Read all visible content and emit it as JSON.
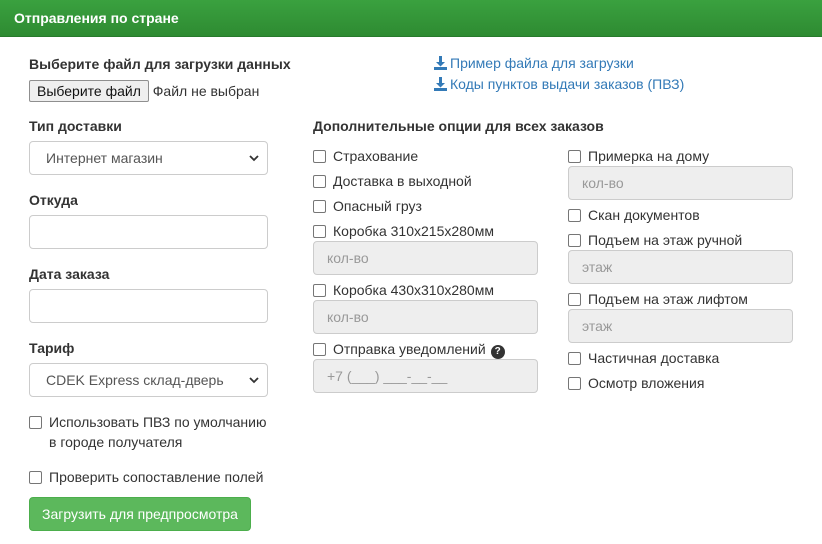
{
  "header": {
    "title": "Отправления по стране"
  },
  "upload": {
    "label": "Выберите файл для загрузки данных",
    "button_label": "Выберите файл",
    "status": "Файл не выбран"
  },
  "links": {
    "sample_file": "Пример файла для загрузки",
    "pvz_codes": "Коды пунктов выдачи заказов (ПВЗ)"
  },
  "form": {
    "delivery_type": {
      "label": "Тип доставки",
      "value": "Интернет магазин"
    },
    "from": {
      "label": "Откуда",
      "value": ""
    },
    "order_date": {
      "label": "Дата заказа",
      "value": ""
    },
    "tariff": {
      "label": "Тариф",
      "value": "CDEK Express склад-дверь"
    },
    "use_pvz": {
      "line1": "Использовать ПВЗ по умолчанию",
      "line2": "в городе получателя",
      "checked": false
    },
    "check_mapping": {
      "label": "Проверить сопоставление полей",
      "checked": false
    },
    "submit_label": "Загрузить для предпросмотра"
  },
  "options": {
    "title": "Дополнительные опции для всех заказов",
    "insurance": "Страхование",
    "weekend_delivery": "Доставка в выходной",
    "dangerous": "Опасный груз",
    "box1": "Коробка 310х215х280мм",
    "box1_placeholder": "кол-во",
    "box2": "Коробка 430х310х280мм",
    "box2_placeholder": "кол-во",
    "notifications": "Отправка уведомлений",
    "phone_placeholder": "+7 (___) ___-__-__",
    "fitting": "Примерка на дому",
    "fitting_placeholder": "кол-во",
    "scan_docs": "Скан документов",
    "lift_manual": "Подъем на этаж ручной",
    "lift_manual_placeholder": "этаж",
    "lift_elevator": "Подъем на этаж лифтом",
    "lift_elevator_placeholder": "этаж",
    "partial_delivery": "Частичная доставка",
    "inspection": "Осмотр вложения"
  },
  "colors": {
    "header": "#2e8b32",
    "link": "#337ab7",
    "submit": "#5cb85c"
  }
}
